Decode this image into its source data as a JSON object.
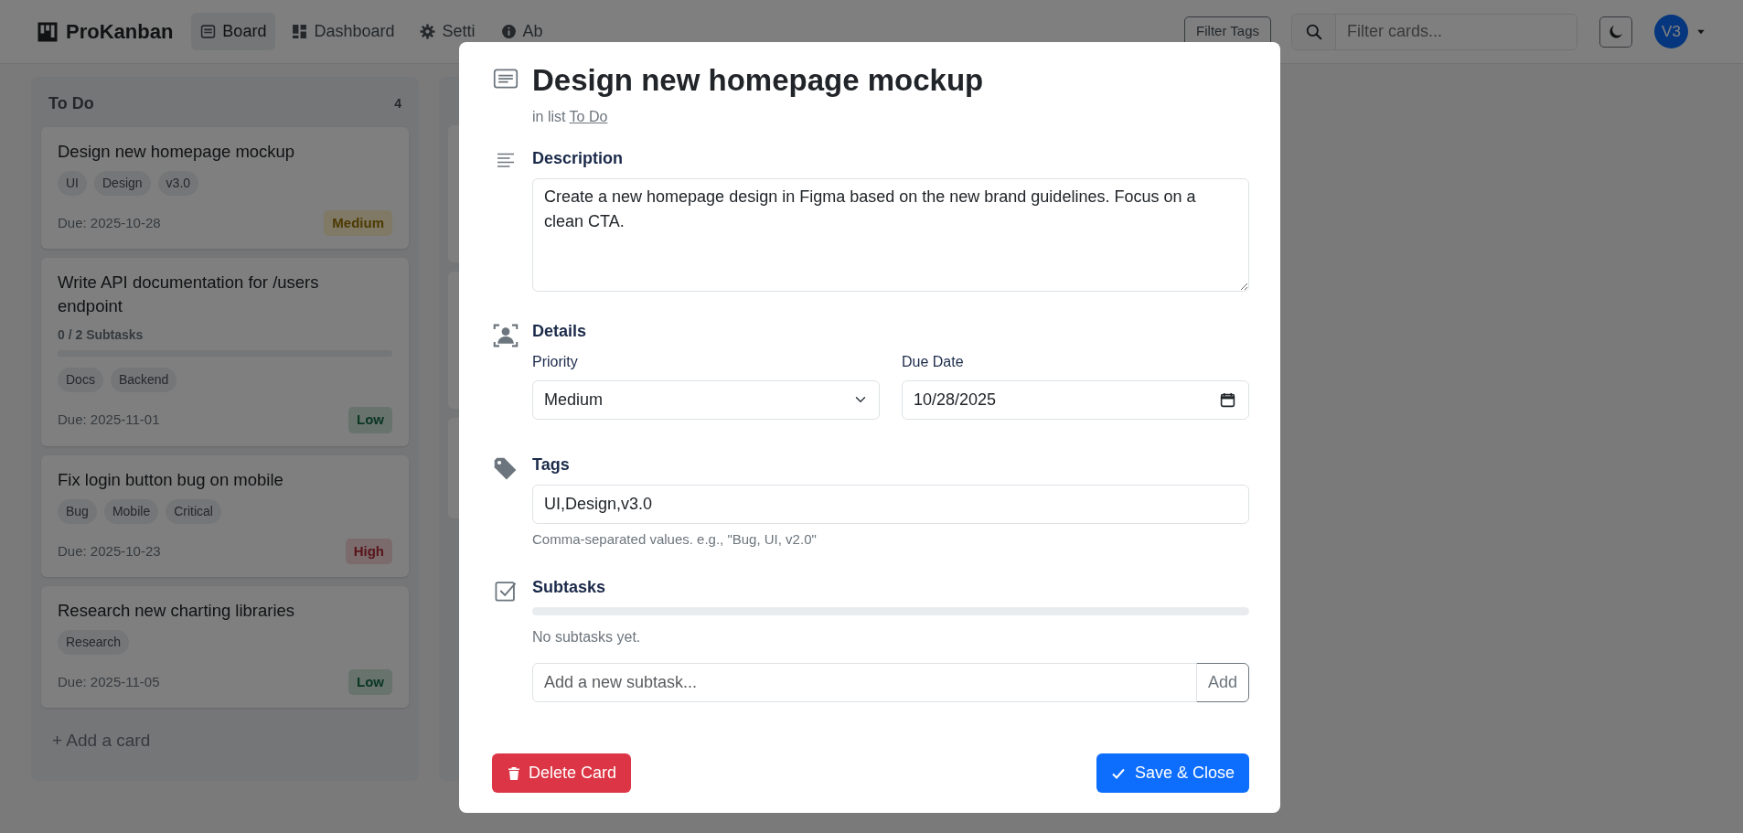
{
  "navbar": {
    "brand": "ProKanban",
    "links": [
      {
        "label": "Board",
        "kind": "board",
        "selected": true
      },
      {
        "label": "Dashboard",
        "kind": "dashboard",
        "selected": false
      },
      {
        "label": "Setti",
        "kind": "settings",
        "selected": false
      },
      {
        "label": "Ab",
        "kind": "about",
        "selected": false
      }
    ],
    "filter_button": "Filter Tags",
    "search": {
      "placeholder": "Filter cards..."
    },
    "avatar": "V3"
  },
  "columns": [
    {
      "title": "To Do",
      "count": "4",
      "cards": [
        {
          "title": "Design new homepage mockup",
          "tags": [
            "UI",
            "Design",
            "v3.0"
          ],
          "due": "Due: 2025-10-28",
          "priority": {
            "label": "Medium",
            "kind": "medium"
          }
        },
        {
          "title": "Write API documentation for /users endpoint",
          "subtasks": {
            "text": "0 / 2 Subtasks",
            "level": 0
          },
          "tags": [
            "Docs",
            "Backend"
          ],
          "due": "Due: 2025-11-01",
          "priority": {
            "label": "Low",
            "kind": "low"
          }
        },
        {
          "title": "Fix login button bug on mobile",
          "tags": [
            "Bug",
            "Mobile",
            "Critical"
          ],
          "due": "Due: 2025-10-23",
          "priority": {
            "label": "High",
            "kind": "high"
          }
        },
        {
          "title": "Research new charting libraries",
          "tags": [
            "Research"
          ],
          "due": "Due: 2025-11-05",
          "priority": {
            "label": "Low",
            "kind": "low"
          }
        }
      ],
      "add_card": "+ Add a card"
    }
  ],
  "modal": {
    "title": "Design new homepage mockup",
    "list_prefix": "in list",
    "list_link": "To Do",
    "description": {
      "label": "Description",
      "value": "Create a new homepage design in Figma based on the new brand guidelines. Focus on a clean CTA."
    },
    "details": {
      "label": "Details",
      "priority_label": "Priority",
      "priority_value": "Medium",
      "due_label": "Due Date",
      "due_value": "10/28/2025"
    },
    "tags": {
      "label": "Tags",
      "value": "UI,Design,v3.0",
      "help": "Comma-separated values. e.g., \"Bug, UI, v2.0\""
    },
    "subtasks": {
      "label": "Subtasks",
      "level": 0,
      "empty_text": "No subtasks yet.",
      "placeholder": "Add a new subtask...",
      "add_button": "Add"
    },
    "delete_button": "Delete Card",
    "save_button": "Save & Close"
  }
}
